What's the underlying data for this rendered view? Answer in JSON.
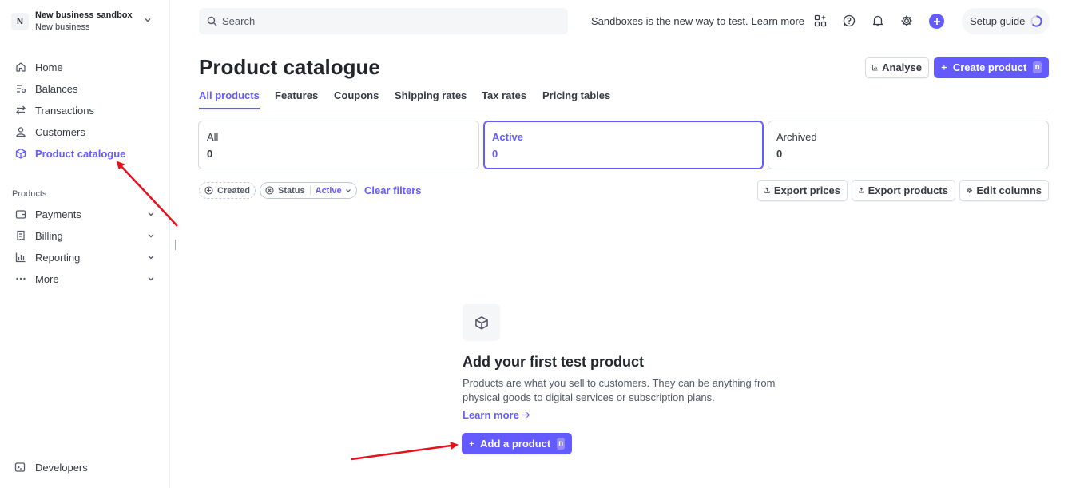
{
  "account": {
    "avatar_letter": "N",
    "name": "New business sandbox",
    "subtitle": "New business"
  },
  "sidebar": {
    "items": [
      {
        "label": "Home",
        "icon": "home-icon"
      },
      {
        "label": "Balances",
        "icon": "balances-icon"
      },
      {
        "label": "Transactions",
        "icon": "transactions-icon"
      },
      {
        "label": "Customers",
        "icon": "customers-icon"
      },
      {
        "label": "Product catalogue",
        "icon": "box-icon",
        "active": true
      }
    ],
    "section_label": "Products",
    "product_items": [
      {
        "label": "Payments",
        "icon": "wallet-icon"
      },
      {
        "label": "Billing",
        "icon": "billing-icon"
      },
      {
        "label": "Reporting",
        "icon": "reporting-icon"
      },
      {
        "label": "More",
        "icon": "more-icon"
      }
    ],
    "developers_label": "Developers"
  },
  "topbar": {
    "search_placeholder": "Search",
    "sandbox_note": "Sandboxes is the new way to test.",
    "learn_more": "Learn more",
    "setup_guide": "Setup guide"
  },
  "header": {
    "title": "Product catalogue",
    "analyse_label": "Analyse",
    "create_label": "Create product",
    "create_shortcut": "n"
  },
  "tabs": [
    "All products",
    "Features",
    "Coupons",
    "Shipping rates",
    "Tax rates",
    "Pricing tables"
  ],
  "filter_cards": [
    {
      "label": "All",
      "count": "0"
    },
    {
      "label": "Active",
      "count": "0",
      "selected": true
    },
    {
      "label": "Archived",
      "count": "0"
    }
  ],
  "filters": {
    "created_label": "Created",
    "status_label": "Status",
    "status_value": "Active",
    "clear_label": "Clear filters"
  },
  "toolbar": {
    "export_prices": "Export prices",
    "export_products": "Export products",
    "edit_columns": "Edit columns"
  },
  "empty_state": {
    "title": "Add your first test product",
    "description": "Products are what you sell to customers. They can be anything from physical goods to digital services or subscription plans.",
    "learn_more": "Learn more",
    "add_label": "Add a product",
    "add_shortcut": "n"
  },
  "colors": {
    "accent": "#635bff",
    "annotation": "#e8101a"
  }
}
